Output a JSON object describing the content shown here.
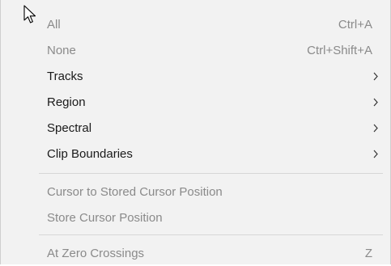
{
  "menu": {
    "items": [
      {
        "label": "All",
        "shortcut": "Ctrl+A",
        "enabled": false,
        "submenu": false
      },
      {
        "label": "None",
        "shortcut": "Ctrl+Shift+A",
        "enabled": false,
        "submenu": false
      },
      {
        "label": "Tracks",
        "shortcut": "",
        "enabled": true,
        "submenu": true
      },
      {
        "label": "Region",
        "shortcut": "",
        "enabled": true,
        "submenu": true
      },
      {
        "label": "Spectral",
        "shortcut": "",
        "enabled": true,
        "submenu": true
      },
      {
        "label": "Clip Boundaries",
        "shortcut": "",
        "enabled": true,
        "submenu": true
      },
      {
        "label": "Cursor to Stored Cursor Position",
        "shortcut": "",
        "enabled": false,
        "submenu": false
      },
      {
        "label": "Store Cursor Position",
        "shortcut": "",
        "enabled": false,
        "submenu": false
      },
      {
        "label": "At Zero Crossings",
        "shortcut": "Z",
        "enabled": false,
        "submenu": false
      }
    ]
  },
  "colors": {
    "background": "#f2f2f2",
    "text_enabled": "#1a1a1a",
    "text_disabled": "#8a8a8a",
    "separator": "#d7d7d7"
  },
  "icons": {
    "submenu": "chevron-right-icon",
    "pointer": "mouse-pointer-icon"
  }
}
